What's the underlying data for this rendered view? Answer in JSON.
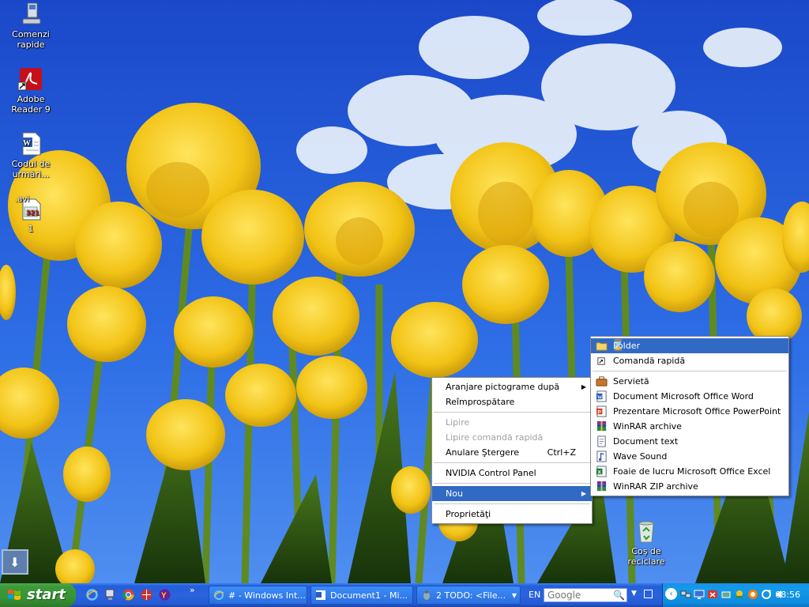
{
  "desktop": {
    "icons": [
      {
        "label": "Comenzi rapide"
      },
      {
        "label": "Adobe Reader 9"
      },
      {
        "label": "Codul de urmări..."
      },
      {
        "label": "1",
        "badge": ".avi"
      },
      {
        "label": "Coş de reciclare"
      }
    ]
  },
  "context_menu": {
    "items": [
      {
        "label": "Aranjare pictograme după",
        "submenu": true
      },
      {
        "label": "Reîmprospătare"
      },
      {
        "label": "Lipire",
        "disabled": true
      },
      {
        "label": "Lipire comandă rapidă",
        "disabled": true
      },
      {
        "label": "Anulare Ştergere",
        "shortcut": "Ctrl+Z"
      },
      {
        "label": "NVIDIA Control Panel"
      },
      {
        "label": "Nou",
        "submenu": true,
        "highlighted": true
      },
      {
        "label": "Proprietăţi"
      }
    ]
  },
  "new_submenu": {
    "items": [
      {
        "label": "Folder",
        "icon": "folder-icon",
        "highlighted": true
      },
      {
        "label": "Comandă rapidă",
        "icon": "shortcut-icon"
      },
      {
        "label": "Servietă",
        "icon": "briefcase-icon"
      },
      {
        "label": "Document Microsoft Office Word",
        "icon": "word-document-icon"
      },
      {
        "label": "Prezentare Microsoft Office PowerPoint",
        "icon": "powerpoint-icon"
      },
      {
        "label": "WinRAR archive",
        "icon": "winrar-icon"
      },
      {
        "label": "Document text",
        "icon": "text-document-icon"
      },
      {
        "label": "Wave Sound",
        "icon": "wave-sound-icon"
      },
      {
        "label": "Foaie de lucru Microsoft Office Excel",
        "icon": "excel-icon"
      },
      {
        "label": "WinRAR ZIP archive",
        "icon": "winrar-zip-icon"
      }
    ]
  },
  "taskbar": {
    "start_label": "start",
    "tasks": [
      {
        "label": "# - Windows Int..."
      },
      {
        "label": "Document1 - Mi..."
      },
      {
        "label": "2 TODO: <File..."
      }
    ],
    "language": "EN",
    "search_placeholder": "Google",
    "clock": "08:56"
  },
  "colors": {
    "menu_highlight": "#316ac5",
    "taskbar_blue": "#245edb",
    "start_green": "#3c9a39",
    "tray_blue": "#139ae8"
  }
}
